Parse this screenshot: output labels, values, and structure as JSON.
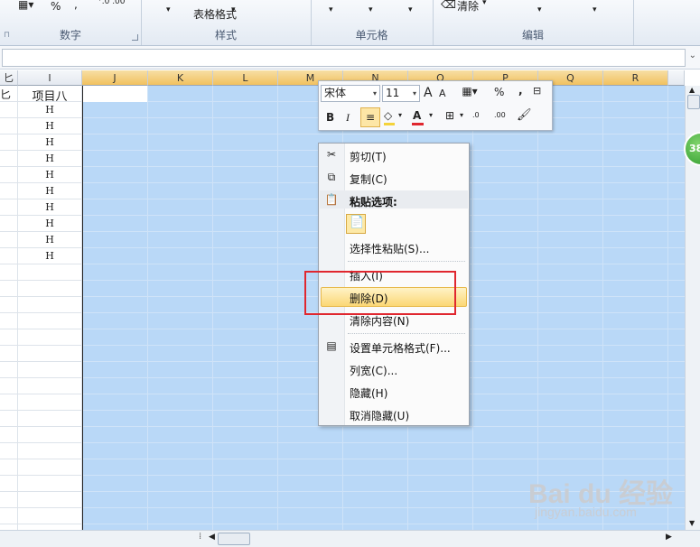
{
  "ribbon": {
    "number_group_label": "数字",
    "style_group_label": "样式",
    "cells_group_label": "单元格",
    "edit_group_label": "编辑",
    "percent_symbol": "%",
    "comma_symbol": ",",
    "table_format_label": "表格格式",
    "table_format_arrow": "▾",
    "clear_label": "清除",
    "clear_arrow": "▾"
  },
  "columns": [
    {
      "name": "匕",
      "selected": false
    },
    {
      "name": "I",
      "selected": false
    },
    {
      "name": "J",
      "selected": true
    },
    {
      "name": "K",
      "selected": true
    },
    {
      "name": "L",
      "selected": true
    },
    {
      "name": "M",
      "selected": true
    },
    {
      "name": "N",
      "selected": true
    },
    {
      "name": "O",
      "selected": true
    },
    {
      "name": "P",
      "selected": true
    },
    {
      "name": "Q",
      "selected": true
    },
    {
      "name": "R",
      "selected": true
    }
  ],
  "grid": {
    "column_i_header_cell": "项目八",
    "left_cut_text": "匕",
    "column_i_values": [
      "H",
      "H",
      "H",
      "H",
      "H",
      "H",
      "H",
      "H",
      "H",
      "H"
    ]
  },
  "mini_toolbar": {
    "font_name": "宋体",
    "font_size": "11",
    "grow_font": "A",
    "shrink_font": "A",
    "percent": "%",
    "comma": ",",
    "bold": "B",
    "italic": "I",
    "font_color_letter": "A",
    "increase_decimal": ".0",
    "decrease_decimal": ".00",
    "font_color": "#e0272f",
    "fill_color": "#f4d33a"
  },
  "context_menu": {
    "items": [
      {
        "label": "剪切(T)"
      },
      {
        "label": "复制(C)"
      },
      {
        "label": "粘贴选项:"
      },
      {
        "label": "选择性粘贴(S)..."
      },
      {
        "label": "插入(I)"
      },
      {
        "label": "删除(D)",
        "highlighted": true
      },
      {
        "label": "清除内容(N)"
      },
      {
        "label": "设置单元格格式(F)..."
      },
      {
        "label": "列宽(C)..."
      },
      {
        "label": "隐藏(H)"
      },
      {
        "label": "取消隐藏(U)"
      }
    ]
  },
  "badge": {
    "text": "38"
  },
  "watermark": {
    "logo": "Bai du 经验",
    "url": "jingyan.baidu.com"
  },
  "colors": {
    "selection": "#b9d8f7",
    "highlight": "#fbd775",
    "annotation_box": "#e0272f"
  }
}
